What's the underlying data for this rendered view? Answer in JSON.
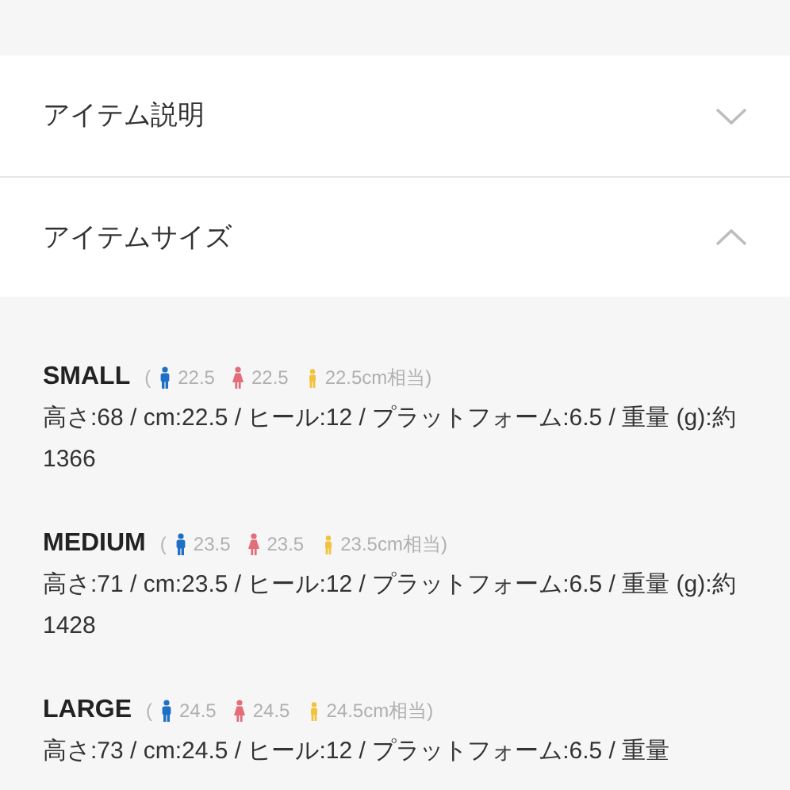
{
  "sections": [
    {
      "title": "アイテム説明",
      "expanded": false
    },
    {
      "title": "アイテムサイズ",
      "expanded": true
    }
  ],
  "sizes": [
    {
      "name": "SMALL",
      "open": "(",
      "figures": [
        {
          "kind": "man",
          "color": "#1f6fc6",
          "text": "22.5"
        },
        {
          "kind": "woman",
          "color": "#e36d78",
          "text": "22.5"
        },
        {
          "kind": "child",
          "color": "#f2c23c",
          "text": "22.5cm相当)"
        }
      ],
      "description": "高さ:68 / cm:22.5 / ヒール:12 / プラットフォーム:6.5 / 重量 (g):約1366"
    },
    {
      "name": "MEDIUM",
      "open": "(",
      "figures": [
        {
          "kind": "man",
          "color": "#1f6fc6",
          "text": "23.5"
        },
        {
          "kind": "woman",
          "color": "#e36d78",
          "text": "23.5"
        },
        {
          "kind": "child",
          "color": "#f2c23c",
          "text": "23.5cm相当)"
        }
      ],
      "description": "高さ:71 / cm:23.5 / ヒール:12 / プラットフォーム:6.5 / 重量 (g):約1428"
    },
    {
      "name": "LARGE",
      "open": "(",
      "figures": [
        {
          "kind": "man",
          "color": "#1f6fc6",
          "text": "24.5"
        },
        {
          "kind": "woman",
          "color": "#e36d78",
          "text": "24.5"
        },
        {
          "kind": "child",
          "color": "#f2c23c",
          "text": "24.5cm相当)"
        }
      ],
      "description": "高さ:73 / cm:24.5 / ヒール:12 / プラットフォーム:6.5 / 重量"
    }
  ]
}
